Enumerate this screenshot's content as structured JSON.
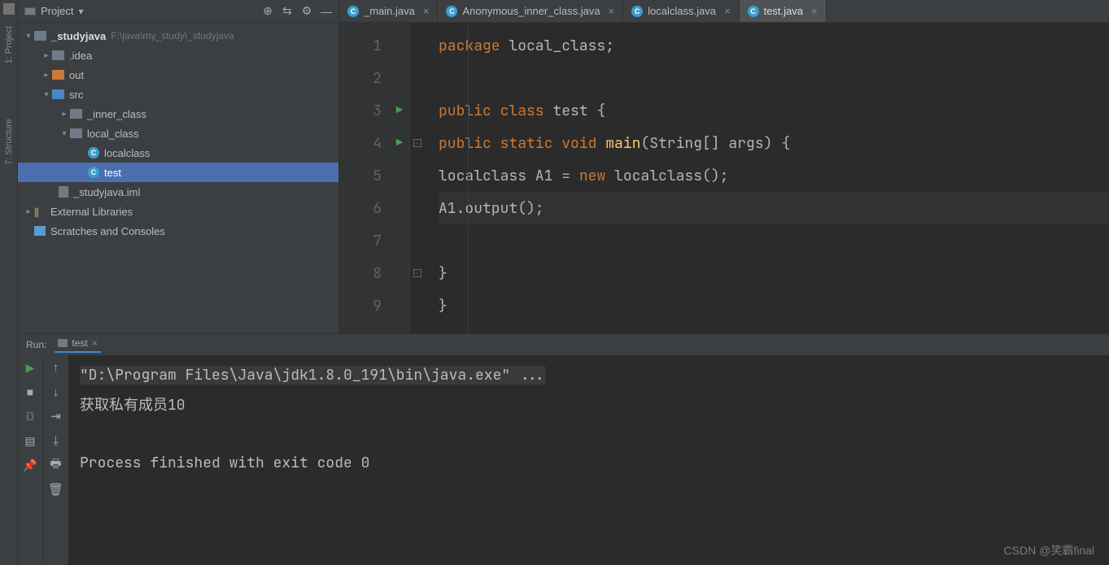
{
  "sidebar": {
    "labels": {
      "project": "1: Project",
      "structure": "7: Structure"
    }
  },
  "project": {
    "title": "Project",
    "tree": {
      "root": {
        "name": "_studyjava",
        "path": "F:\\java\\my_study\\_studyjava"
      },
      "idea": ".idea",
      "out": "out",
      "src": "src",
      "inner_class": "_inner_class",
      "local_class": "local_class",
      "localclass": "localclass",
      "test": "test",
      "iml": "_studyjava.iml",
      "ext": "External Libraries",
      "scratch": "Scratches and Consoles"
    }
  },
  "tabs": [
    {
      "label": "_main.java"
    },
    {
      "label": "Anonymous_inner_class.java"
    },
    {
      "label": "localclass.java"
    },
    {
      "label": "test.java"
    }
  ],
  "editor": {
    "lines": [
      "1",
      "2",
      "3",
      "4",
      "5",
      "6",
      "7",
      "8",
      "9"
    ],
    "code": {
      "l1_kw": "package ",
      "l1_id": "local_class;",
      "l3_kw1": "public class ",
      "l3_id": "test ",
      "l3_br": "{",
      "l4_kw": "public static void ",
      "l4_fn": "main",
      "l4_rest": "(String[] args) {",
      "l5": "localclass A1 = ",
      "l5_kw": "new ",
      "l5_rest": "localclass();",
      "l6": "A1.output();",
      "l8": "}",
      "l9": "}"
    }
  },
  "run": {
    "label": "Run:",
    "tab": "test",
    "console": {
      "cmd": "\"D:\\Program Files\\Java\\jdk1.8.0_191\\bin\\java.exe\" ...",
      "out1": "获取私有成员10",
      "exit": "Process finished with exit code 0"
    }
  },
  "watermark": "CSDN @笑霸final"
}
